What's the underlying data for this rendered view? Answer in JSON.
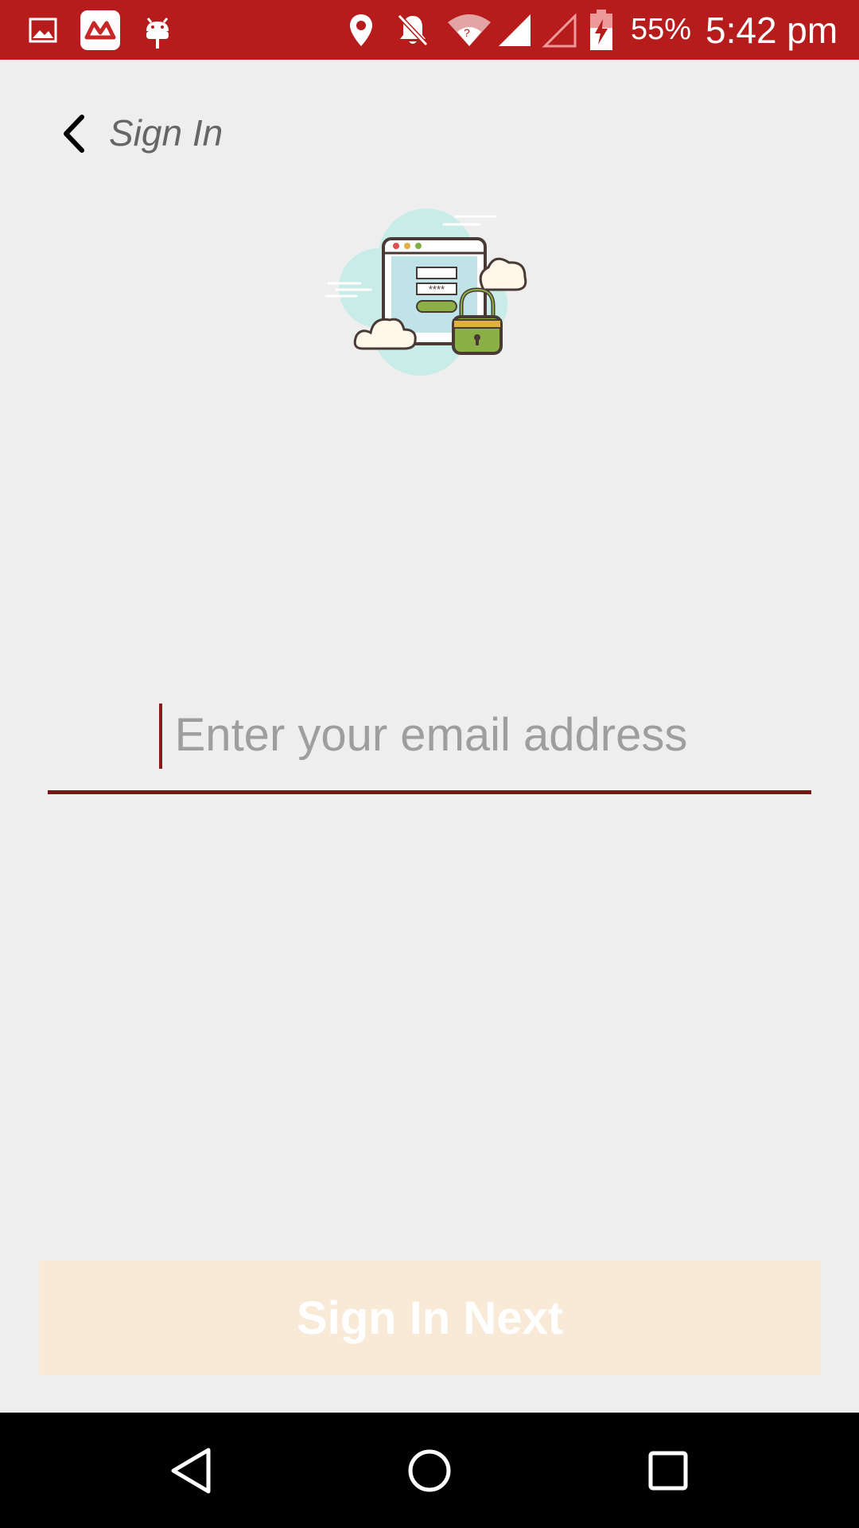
{
  "status_bar": {
    "battery_percent": "55%",
    "time": "5:42 pm",
    "icons": [
      "gallery-icon",
      "app-logo-icon",
      "android-debug-icon",
      "location-icon",
      "notifications-off-icon",
      "wifi-icon",
      "signal-icon",
      "signal-empty-icon",
      "battery-charging-icon"
    ]
  },
  "header": {
    "title": "Sign In",
    "back_icon": "chevron-left-icon"
  },
  "illustration": {
    "name": "secure-login-illustration",
    "password_mask": "****"
  },
  "email_input": {
    "placeholder": "Enter your email address",
    "value": ""
  },
  "primary_button": {
    "label": "Sign In Next"
  },
  "nav_bar": {
    "buttons": [
      "back-icon",
      "home-icon",
      "recents-icon"
    ]
  },
  "colors": {
    "status_bar": "#b71c1c",
    "background": "#eeeeee",
    "underline": "#7f1212",
    "button_bg": "#f9ead8"
  }
}
